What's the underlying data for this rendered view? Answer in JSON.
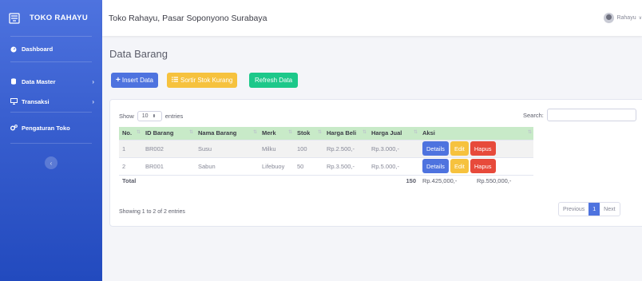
{
  "sidebar": {
    "brand": "TOKO RAHAYU",
    "items": [
      {
        "label": "Dashboard"
      },
      {
        "label": "Data Master"
      },
      {
        "label": "Transaksi"
      },
      {
        "label": "Pengaturan Toko"
      }
    ]
  },
  "topbar": {
    "title": "Toko Rahayu, Pasar Soponyono Surabaya",
    "user": "Rahayu"
  },
  "main": {
    "page_title": "Data Barang",
    "buttons": {
      "insert": "Insert Data",
      "sort": "Sortir Stok Kurang",
      "refresh": "Refresh Data"
    },
    "table": {
      "show_label": "Show",
      "entries_value": "10",
      "entries_label": "entries",
      "search_label": "Search:",
      "headers": [
        "No.",
        "ID Barang",
        "Nama Barang",
        "Merk",
        "Stok",
        "Harga Beli",
        "Harga Jual",
        "Aksi"
      ],
      "rows": [
        {
          "no": "1",
          "id": "BR002",
          "nama": "Susu",
          "merk": "Milku",
          "stok": "100",
          "beli": "Rp.2.500,-",
          "jual": "Rp.3.000,-"
        },
        {
          "no": "2",
          "id": "BR001",
          "nama": "Sabun",
          "merk": "Lifebuoy",
          "stok": "50",
          "beli": "Rp.3.500,-",
          "jual": "Rp.5.000,-"
        }
      ],
      "actions": {
        "details": "Details",
        "edit": "Edit",
        "hapus": "Hapus"
      },
      "total": {
        "label": "Total",
        "stok": "150",
        "beli": "Rp.425,000,-",
        "jual": "Rp.550,000,-"
      },
      "info": "Showing 1 to 2 of 2 entries",
      "pager": {
        "prev": "Previous",
        "page": "1",
        "next": "Next"
      }
    }
  },
  "colors": {
    "sidebar": "#4e73df",
    "primary": "#4e73df",
    "warning": "#f6c23e",
    "success": "#1cc88a",
    "danger": "#e74a3b",
    "header_bg": "#c8eac8"
  }
}
